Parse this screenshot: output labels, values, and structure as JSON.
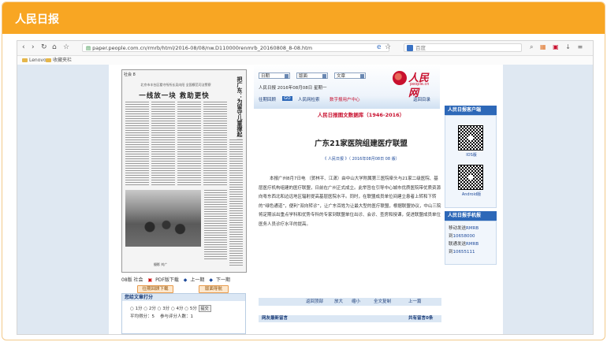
{
  "card": {
    "title": "人民日报"
  },
  "browser": {
    "url": "paper.people.com.cn/rmrb/html/2016-08/08/nw.D110000renmrb_20160808_8-08.htm",
    "search_placeholder": "百度",
    "bookmarks": [
      "Lenovo",
      "收藏夹栏"
    ]
  },
  "paper": {
    "page_label": "社会 8",
    "subtitle": "北京市丰台区看守所所长吴向阳 全国模范司法警察",
    "headline": "一线放一块 救助更快",
    "vertical_title": "把广东：为留守儿童撑起一片天",
    "photo_caption": "摄影 刘广",
    "below": {
      "page": "08版 社会",
      "pdf": "PDF版下载",
      "prev": "上一期",
      "next": "下一期"
    },
    "buttons": [
      "往期回顾下载",
      "版面导航"
    ]
  },
  "vote": {
    "title": "您给文章打分",
    "options": [
      "1分",
      "2分",
      "3分",
      "4分",
      "5分"
    ],
    "submit": "提交",
    "avg_label": "平均得分：",
    "avg_value": "5",
    "count_label": "参与评分人数：",
    "count_value": "1"
  },
  "header": {
    "selects": [
      "日期",
      "版面",
      "文章"
    ],
    "date_line": "人民日报 2016年08月08日 星期一",
    "logo_text": "人民网",
    "logo_url": "people.cn",
    "nav": [
      "往期回顾",
      "人民网检索",
      "数字报用户中心",
      "返回目录"
    ]
  },
  "article": {
    "database": "人民日报图文数据库（1946-2016）",
    "title": "广东21家医院组建医疗联盟",
    "meta": "《 人民日报 》（ 2016年08月08日 08 版）",
    "body": "本报广州8月7日电 （贺林平、江潇）由中山大学附属第三医院牵头与21家二级医院、基层医疗机构组建的医疗联盟，日前在广州正式成立。此举旨在引导中心城市优质医院带优质资源向粤东西北和边远地区辐射提高基层医院水平。同时，在联盟成员单位间建立患者上转和下转的“绿色通道”，便利“双向转诊”，让广东百姓为让最大型的医疗联盟，根据联盟协议，中山三院将定期派出重点学科和优势专科的专家到联盟单位出诊、会诊、查房和授课，促进联盟成员单位医务人员诊疗水平的提高。",
    "footer": [
      "返回顶部",
      "放大",
      "缩小",
      "全文复制",
      "上一篇"
    ],
    "comments_title": "网友最新留言",
    "comments_count": "共有留言0条"
  },
  "sidebar": {
    "client_title": "人民日报客户端",
    "ios_label": "IOS版",
    "android_label": "Android版",
    "mobile_title": "人民日报手机报",
    "mobile_lines": [
      {
        "prefix": "移动发送",
        "code": "RMRB"
      },
      {
        "prefix": "到",
        "code": "10658000"
      },
      {
        "prefix": "联通发送",
        "code": "RMRB"
      },
      {
        "prefix": "到",
        "code": "10655111"
      }
    ]
  }
}
